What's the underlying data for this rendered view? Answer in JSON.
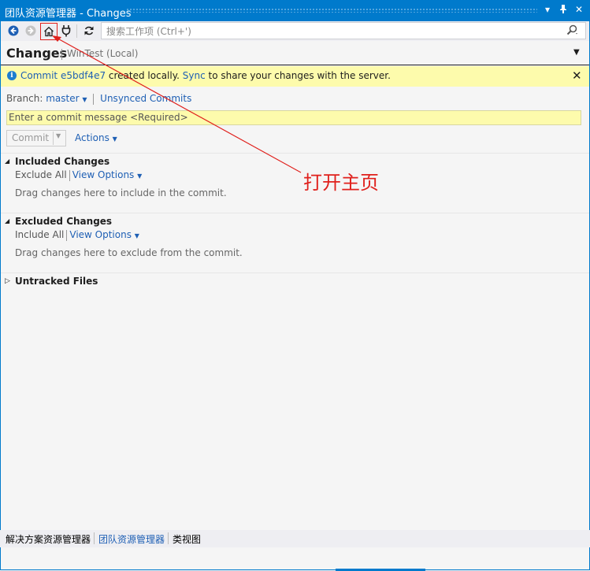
{
  "window": {
    "title": "团队资源管理器 - Changes",
    "buttons": [
      "▾",
      "ᵖ",
      "✕"
    ]
  },
  "toolbar": {
    "search_placeholder": "搜索工作项 (Ctrl+')",
    "icons": [
      "back-icon",
      "forward-icon",
      "home-icon",
      "connect-icon",
      "refresh-icon",
      "search-icon"
    ]
  },
  "header": {
    "title": "Changes",
    "repo": "WinTest (Local)"
  },
  "info_bar": {
    "icon": "i",
    "commit_link": "Commit e5bdf4e7",
    "text_mid": " created locally. ",
    "sync_link": "Sync",
    "text_end": " to share your changes with the server.",
    "close": "✕"
  },
  "branch": {
    "label": "Branch:",
    "name": "master",
    "unsynced": "Unsynced Commits"
  },
  "commit_message": {
    "placeholder": "Enter a commit message <Required>"
  },
  "commit_bar": {
    "commit_label": "Commit",
    "actions_label": "Actions"
  },
  "sections": {
    "included": {
      "title": "Included Changes",
      "exclude_all": "Exclude All",
      "view_options": "View Options",
      "hint": "Drag changes here to include in the commit."
    },
    "excluded": {
      "title": "Excluded Changes",
      "include_all": "Include All",
      "view_options": "View Options",
      "hint": "Drag changes here to exclude from the commit."
    },
    "untracked": {
      "title": "Untracked Files"
    }
  },
  "annotation": {
    "text": "打开主页",
    "color": "#e0201c"
  },
  "bottom_tabs": [
    "解决方案资源管理器",
    "团队资源管理器",
    "类视图"
  ],
  "colors": {
    "accent": "#007acc",
    "link": "#1e5fb4",
    "info_bg": "#fdfbac"
  }
}
